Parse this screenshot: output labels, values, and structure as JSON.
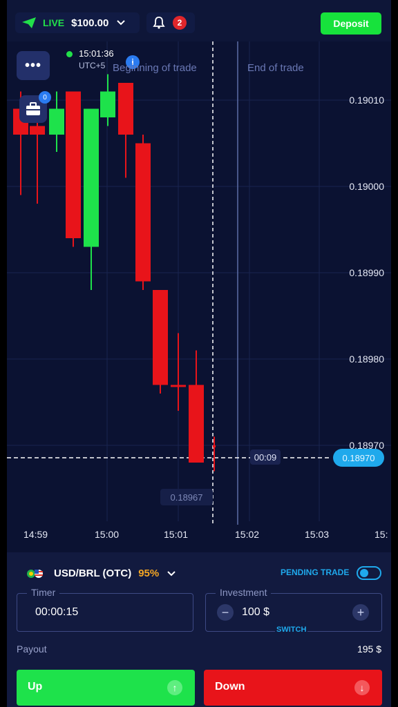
{
  "topbar": {
    "account_mode": "LIVE",
    "balance": "$100.00",
    "notification_count": "2",
    "deposit_label": "Deposit"
  },
  "chart": {
    "clock": "15:01:36",
    "timezone": "UTC+5",
    "portfolio_count": "0",
    "info_label": "i",
    "beginning_label": "Beginning of trade",
    "end_label": "End of trade",
    "price_ticks": [
      "0.19010",
      "0.19000",
      "0.18990",
      "0.18980",
      "0.18970"
    ],
    "time_ticks": [
      "14:59",
      "15:00",
      "15:01",
      "15:02",
      "15:03",
      "15:"
    ],
    "countdown": "00:09",
    "current_price": "0.18970",
    "low_price": "0.18967",
    "candles": [
      {
        "dir": "down",
        "open": 0.19009,
        "close": 0.19006,
        "high": 0.19011,
        "low": 0.18999
      },
      {
        "dir": "down",
        "open": 0.19007,
        "close": 0.19006,
        "high": 0.19008,
        "low": 0.18998
      },
      {
        "dir": "up",
        "open": 0.19006,
        "close": 0.19009,
        "high": 0.19011,
        "low": 0.19004
      },
      {
        "dir": "down",
        "open": 0.19011,
        "close": 0.18994,
        "high": 0.19011,
        "low": 0.18993
      },
      {
        "dir": "up",
        "open": 0.18993,
        "close": 0.19009,
        "high": 0.19009,
        "low": 0.18988
      },
      {
        "dir": "up",
        "open": 0.19008,
        "close": 0.19011,
        "high": 0.19013,
        "low": 0.19007
      },
      {
        "dir": "down",
        "open": 0.19012,
        "close": 0.19006,
        "high": 0.19012,
        "low": 0.19001
      },
      {
        "dir": "down",
        "open": 0.19005,
        "close": 0.18989,
        "high": 0.19006,
        "low": 0.18988
      },
      {
        "dir": "down",
        "open": 0.18988,
        "close": 0.18977,
        "high": 0.18988,
        "low": 0.18976
      },
      {
        "dir": "down",
        "open": 0.18977,
        "close": 0.18977,
        "high": 0.18983,
        "low": 0.18974
      },
      {
        "dir": "down",
        "open": 0.18977,
        "close": 0.18968,
        "high": 0.18981,
        "low": 0.18968
      },
      {
        "dir": "down",
        "open": 0.1897,
        "close": 0.1897,
        "high": 0.18971,
        "low": 0.18967
      }
    ]
  },
  "trade": {
    "asset": "USD/BRL (OTC)",
    "payout_percent": "95%",
    "pending_trade_label": "PENDING TRADE",
    "timer_label": "Timer",
    "timer_value": "00:00:15",
    "investment_label": "Investment",
    "investment_value": "100 $",
    "switch_label": "SWITCH",
    "payout_label": "Payout",
    "payout_value": "195 $",
    "up_label": "Up",
    "down_label": "Down"
  },
  "colors": {
    "background": "#0b1232",
    "bull": "#1ee24b",
    "bear": "#e8141a",
    "accent": "#1fa9ec",
    "payout_highlight": "#f5a623"
  }
}
